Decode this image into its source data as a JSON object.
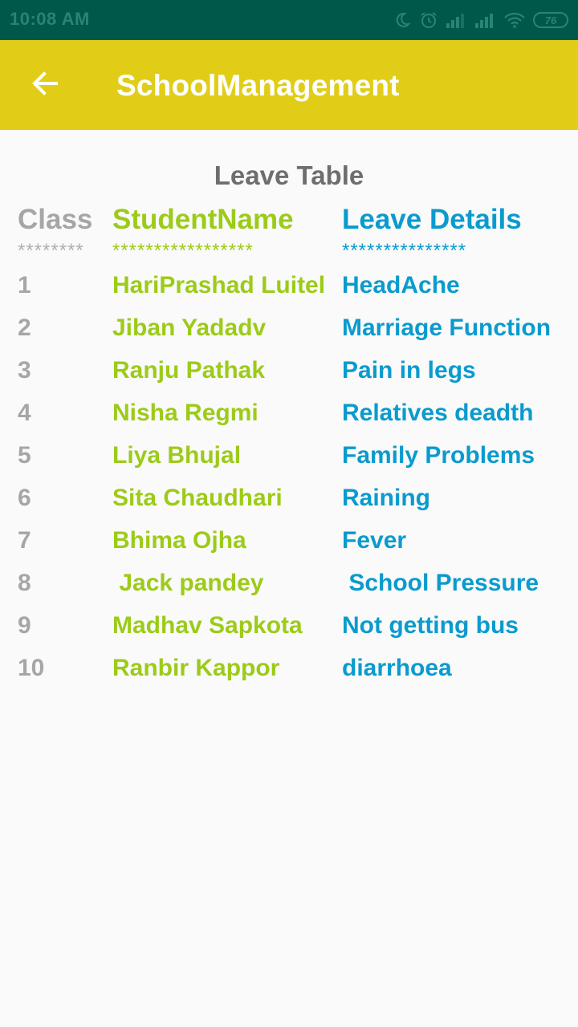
{
  "status_bar": {
    "time": "10:08 AM",
    "battery": "76",
    "icons": [
      "moon-icon",
      "alarm-icon",
      "signal-icon",
      "signal-icon",
      "wifi-icon",
      "battery-icon"
    ]
  },
  "app_bar": {
    "title": "SchoolManagement",
    "back_icon": "arrow-left-icon"
  },
  "page": {
    "title": "Leave Table"
  },
  "table": {
    "headers": [
      "Class",
      "StudentName",
      "Leave Details"
    ],
    "separators": [
      "********",
      "*****************",
      "***************"
    ],
    "rows": [
      [
        "1",
        "HariPrashad Luitel",
        "HeadAche"
      ],
      [
        "2",
        "Jiban Yadadv",
        "Marriage Function"
      ],
      [
        "3",
        "Ranju Pathak",
        "Pain in legs"
      ],
      [
        "4",
        "Nisha Regmi",
        "Relatives deadth"
      ],
      [
        "5",
        "Liya Bhujal",
        "Family Problems"
      ],
      [
        "6",
        "Sita Chaudhari",
        "Raining"
      ],
      [
        "7",
        "Bhima Ojha",
        "Fever"
      ],
      [
        "8",
        " Jack pandey",
        " School Pressure"
      ],
      [
        "9",
        "Madhav Sapkota",
        "Not getting bus"
      ],
      [
        "10",
        "Ranbir Kappor",
        "diarrhoea"
      ]
    ]
  },
  "colors": {
    "status_bar": "#00584a",
    "app_bar": "#e1cd17",
    "class_column": "#a6a6a6",
    "student_column": "#9ccb18",
    "leave_column": "#0a9bce"
  }
}
